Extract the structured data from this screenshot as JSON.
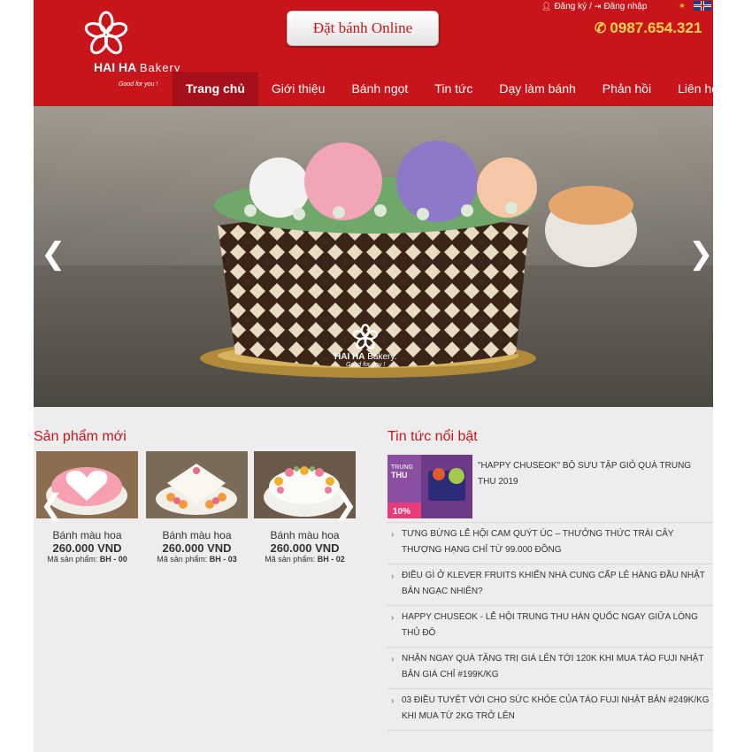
{
  "header": {
    "logo": {
      "brand_bold": "HAI HA",
      "brand_light": "Bakery",
      "tagline": "Good for you !"
    },
    "order_button": "Đặt bánh Online",
    "register": "Đăng ký",
    "separator": "/",
    "login": "Đăng nhập",
    "phone": "0987.654.321"
  },
  "nav": [
    {
      "label": "Trang chủ",
      "active": true
    },
    {
      "label": "Giới thiệu",
      "active": false
    },
    {
      "label": "Bánh ngọt",
      "active": false
    },
    {
      "label": "Tin tức",
      "active": false
    },
    {
      "label": "Dạy làm bánh",
      "active": false
    },
    {
      "label": "Phản hồi",
      "active": false
    },
    {
      "label": "Liên hệ",
      "active": false
    }
  ],
  "banner": {
    "logo_bold": "HAI HA",
    "logo_light": "Bakery.",
    "logo_tagline": "Good for you !"
  },
  "products_section": {
    "title": "Sản phẩm mới",
    "items": [
      {
        "name": "Bánh màu hoa",
        "price": "260.000 VND",
        "code_label": "Mã sản phẩm:",
        "code": "BH - 00"
      },
      {
        "name": "Bánh màu hoa",
        "price": "260.000 VND",
        "code_label": "Mã sản phẩm:",
        "code": "BH - 03"
      },
      {
        "name": "Bánh màu hoa",
        "price": "260.000 VND",
        "code_label": "Mã sản phẩm:",
        "code": "BH - 02"
      }
    ]
  },
  "news_section": {
    "title": "Tin tức nổi bật",
    "featured": {
      "title": "\"HAPPY CHUSEOK\" BỘ SƯU TẬP GIỎ QUÀ TRUNG THU 2019",
      "image_text_1": "TRUNG",
      "image_text_2": "THU",
      "image_badge": "10%"
    },
    "items": [
      "TƯNG BỪNG LỄ HỘI CAM QUÝT ÚC – THƯỞNG THỨC TRÁI CÂY THƯỢNG HẠNG CHỈ TỪ 99.000 ĐỒNG",
      "ĐIỀU GÌ Ở KLEVER FRUITS KHIẾN NHÀ CUNG CẤP LÊ HÀNG ĐẦU NHẬT BẢN NGẠC NHIÊN?",
      "HAPPY CHUSEOK - LỄ HỘI TRUNG THU HÀN QUỐC NGAY GIỮA LÒNG THỦ ĐÔ",
      "NHẬN NGAY QUÀ TẶNG TRỊ GIÁ LÊN TỚI 120K KHI MUA TÁO FUJI NHẬT BẢN GIÁ CHỈ #199K/KG",
      "03 ĐIỀU TUYỆT VỜI CHO SỨC KHỎE CỦA TÁO FUJI NHẬT BẢN #249K/KG KHI MUA TỪ 2KG TRỞ LÊN"
    ]
  },
  "colors": {
    "brand_red": "#c8151b",
    "nav_active": "#a5101a",
    "phone": "#ffd44a",
    "page_bg": "#ededed"
  }
}
